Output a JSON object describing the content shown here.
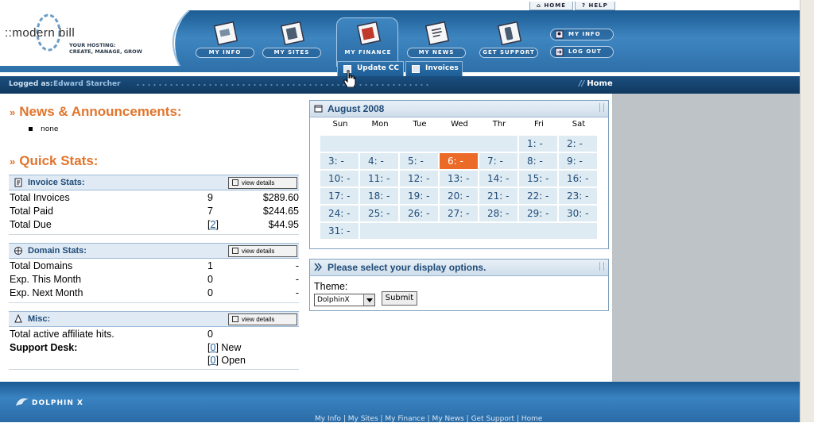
{
  "toplinks": {
    "home": "⌂ HOME",
    "help": "? HELP"
  },
  "brand": {
    "logo": "::modern bill",
    "tagline_1": "YOUR HOSTING:",
    "tagline_2": "CREATE, MANAGE, GROW"
  },
  "nav": {
    "my_info": "MY INFO",
    "my_sites": "MY SITES",
    "my_finance": "MY FINANCE",
    "my_news": "MY NEWS",
    "get_support": "GET SUPPORT",
    "small_my_info": "MY INFO",
    "small_log_out": "LOG OUT"
  },
  "subtabs": {
    "update_cc": "Update CC",
    "invoices": "Invoices"
  },
  "session": {
    "label": "Logged as:",
    "user": "Edward Starcher",
    "crumb": "Home",
    "crumb_prefix": "//"
  },
  "news": {
    "title": "News & Announcements:",
    "items": [
      "none"
    ]
  },
  "quick": {
    "title": "Quick Stats:",
    "view_details": "view details"
  },
  "invoice": {
    "title": "Invoice Stats:",
    "rows": [
      {
        "label": "Total Invoices",
        "count": "9",
        "amount": "$289.60"
      },
      {
        "label": "Total Paid",
        "count": "7",
        "amount": "$244.65"
      },
      {
        "label": "Total Due",
        "count": "2",
        "amount": "$44.95"
      }
    ]
  },
  "domain": {
    "title": "Domain Stats:",
    "rows": [
      {
        "label": "Total Domains",
        "count": "1",
        "amount": "-"
      },
      {
        "label": "Exp. This Month",
        "count": "0",
        "amount": "-"
      },
      {
        "label": "Exp. Next Month",
        "count": "0",
        "amount": "-"
      }
    ]
  },
  "misc": {
    "title": "Misc:",
    "affiliate_label": "Total active affiliate hits.",
    "affiliate_count": "0",
    "support_label": "Support Desk:",
    "support_new_count": "0",
    "support_new": "New",
    "support_open_count": "0",
    "support_open": "Open"
  },
  "calendar": {
    "title": "August 2008",
    "days_of_week": [
      "Sun",
      "Mon",
      "Tue",
      "Wed",
      "Thr",
      "Fri",
      "Sat"
    ],
    "first_weekday": 5,
    "days": 31,
    "today": 6,
    "day_suffix": ": -"
  },
  "options": {
    "title": "Please select your display options.",
    "theme_label": "Theme:",
    "theme_value": "DolphinX",
    "submit": "Submit"
  },
  "footer": {
    "brand": "DOLPHIN X",
    "links": "My Info | My Sites | My Finance | My News | Get Support | Home"
  }
}
